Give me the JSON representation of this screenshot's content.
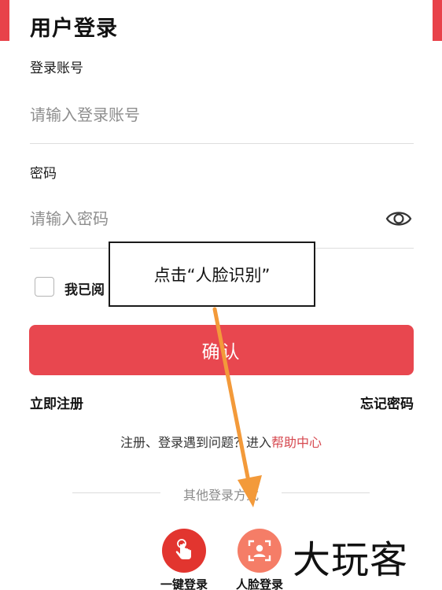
{
  "page": {
    "title": "用户登录"
  },
  "account": {
    "label": "登录账号",
    "placeholder": "请输入登录账号"
  },
  "password": {
    "label": "密码",
    "placeholder": "请输入密码"
  },
  "agreement": {
    "text": "我已阅"
  },
  "confirm_button": {
    "label": "确认"
  },
  "links": {
    "register": "立即注册",
    "forgot_password": "忘记密码"
  },
  "help": {
    "prefix": "注册、登录遇到问题？进入",
    "link": "帮助中心"
  },
  "other_login": {
    "title": "其他登录方式",
    "options": [
      {
        "label": "一键登录",
        "icon": "tap-hand-icon"
      },
      {
        "label": "人脸登录",
        "icon": "face-scan-icon"
      }
    ]
  },
  "annotation": {
    "callout": "点击“人脸识别”"
  },
  "watermark": {
    "text": "大玩客"
  },
  "colors": {
    "brand_red": "#e8474f",
    "onekey_red": "#e2352f",
    "face_salmon": "#f57d67",
    "help_link": "#d6484f",
    "arrow_orange": "#f39a3a"
  }
}
